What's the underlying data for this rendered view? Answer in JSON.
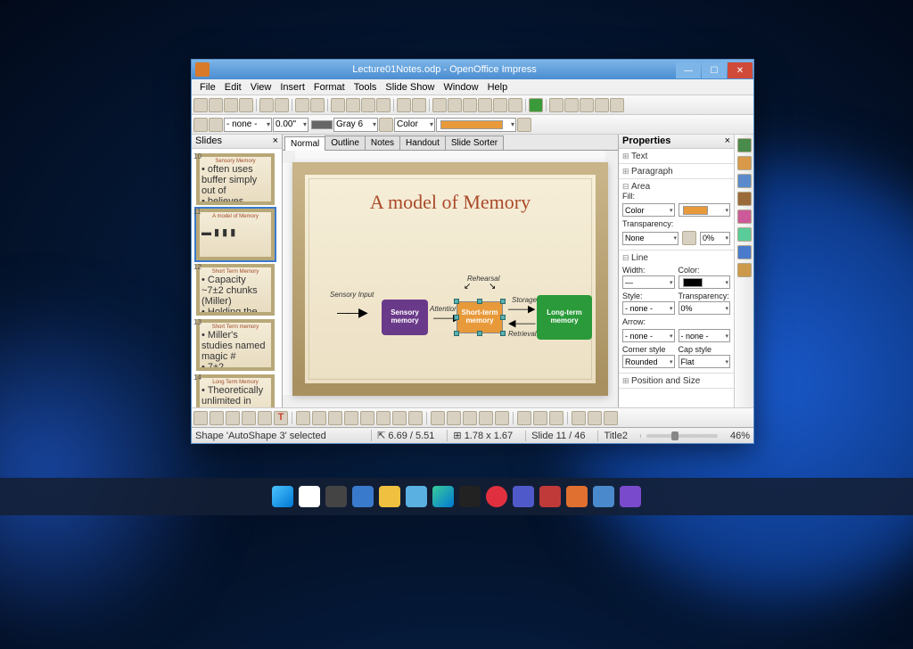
{
  "window": {
    "title": "Lecture01Notes.odp - OpenOffice Impress"
  },
  "menu": [
    "File",
    "Edit",
    "View",
    "Insert",
    "Format",
    "Tools",
    "Slide Show",
    "Window",
    "Help"
  ],
  "toolbar2": {
    "style": "- none -",
    "width_num": "0.00\"",
    "line_color": "Gray 6",
    "fill_mode": "Color"
  },
  "slides_panel": {
    "title": "Slides",
    "thumbs": [
      {
        "n": "10",
        "title": "Sensory Memory"
      },
      {
        "n": "11",
        "title": "A model of Memory"
      },
      {
        "n": "12",
        "title": "Short Term Memory"
      },
      {
        "n": "13",
        "title": "Short Term memory"
      },
      {
        "n": "14",
        "title": "Long Term Memory"
      }
    ]
  },
  "tabs": [
    "Normal",
    "Outline",
    "Notes",
    "Handout",
    "Slide Sorter"
  ],
  "slide": {
    "title": "A model of Memory",
    "boxes": {
      "sensory": "Sensory memory",
      "short": "Short-term memory",
      "long": "Long-term memory"
    },
    "labels": {
      "input": "Sensory Input",
      "attention": "Attention",
      "rehearsal": "Rehearsal",
      "storage": "Storage",
      "retrieval": "Retrieval"
    }
  },
  "properties": {
    "title": "Properties",
    "sections": {
      "text": "Text",
      "paragraph": "Paragraph",
      "area": "Area",
      "line": "Line",
      "pos": "Position and Size"
    },
    "area": {
      "fill_lbl": "Fill:",
      "fill_mode": "Color",
      "trans_lbl": "Transparency:",
      "trans_mode": "None",
      "trans_val": "0%"
    },
    "line": {
      "width_lbl": "Width:",
      "color_lbl": "Color:",
      "style_lbl": "Style:",
      "style": "- none -",
      "trans_lbl": "Transparency:",
      "trans": "0%",
      "arrow_lbl": "Arrow:",
      "arrow1": "- none -",
      "arrow2": "- none -",
      "corner_lbl": "Corner style",
      "corner": "Rounded",
      "cap_lbl": "Cap style",
      "cap": "Flat"
    }
  },
  "status": {
    "shape": "Shape 'AutoShape 3' selected",
    "pos": "6.69 / 5.51",
    "size": "1.78 x 1.67",
    "slide": "Slide 11 / 46",
    "layout": "Title2",
    "zoom": "46%"
  },
  "colors": {
    "orange": "#e89a3a"
  }
}
